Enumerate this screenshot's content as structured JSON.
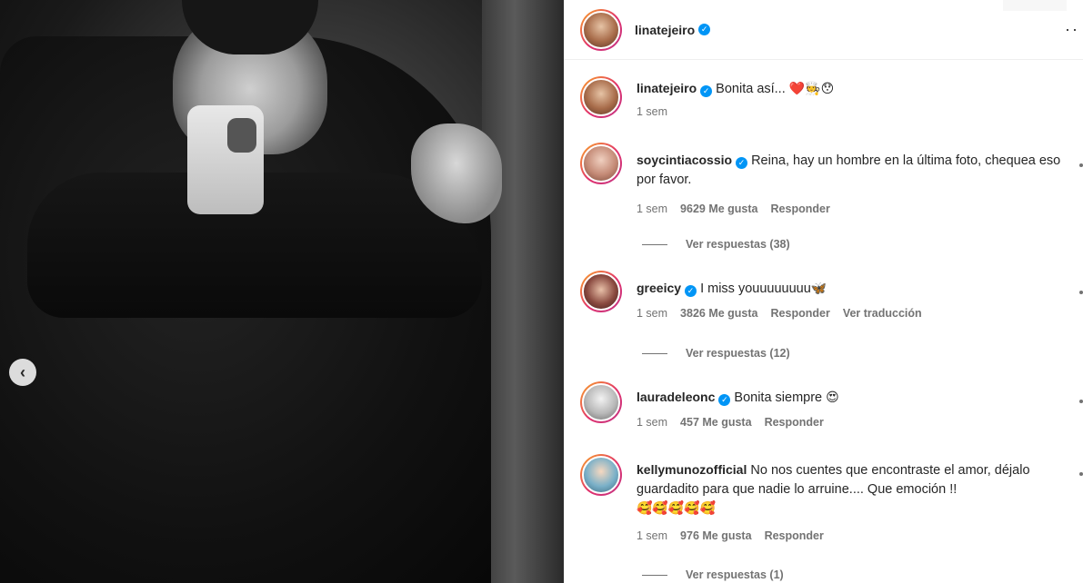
{
  "post": {
    "author": "linatejeiro"
  },
  "caption": {
    "username": "linatejeiro",
    "text": "Bonita así... ",
    "emojis": "❤️🧑‍🍳😯",
    "time": "1 sem"
  },
  "comments": [
    {
      "username": "soycintiacossio",
      "verified": true,
      "text": "Reina, hay un hombre en la última foto, chequea eso por favor.",
      "time": "1 sem",
      "likes": "9629 Me gusta",
      "reply": "Responder",
      "view_replies": "Ver respuestas (38)"
    },
    {
      "username": "greeicy",
      "verified": true,
      "text": "I miss youuuuuuuu",
      "emojis": "🦋",
      "time": "1 sem",
      "likes": "3826 Me gusta",
      "reply": "Responder",
      "translate": "Ver traducción",
      "view_replies": "Ver respuestas (12)"
    },
    {
      "username": "lauradeleonc",
      "verified": true,
      "text": "Bonita siempre",
      "emojis": "😍",
      "time": "1 sem",
      "likes": "457 Me gusta",
      "reply": "Responder"
    },
    {
      "username": "kellymunozofficial",
      "verified": false,
      "text": "No nos cuentes que encontraste el amor, déjalo guardadito para que nadie lo arruine.... Que emoción !!",
      "emojis": "🥰🥰🥰🥰🥰",
      "time": "1 sem",
      "likes": "976 Me gusta",
      "reply": "Responder",
      "view_replies": "Ver respuestas (1)"
    }
  ],
  "nav": {
    "prev_icon": "chevron-left-icon",
    "more_icon": "more-horizontal-icon"
  }
}
